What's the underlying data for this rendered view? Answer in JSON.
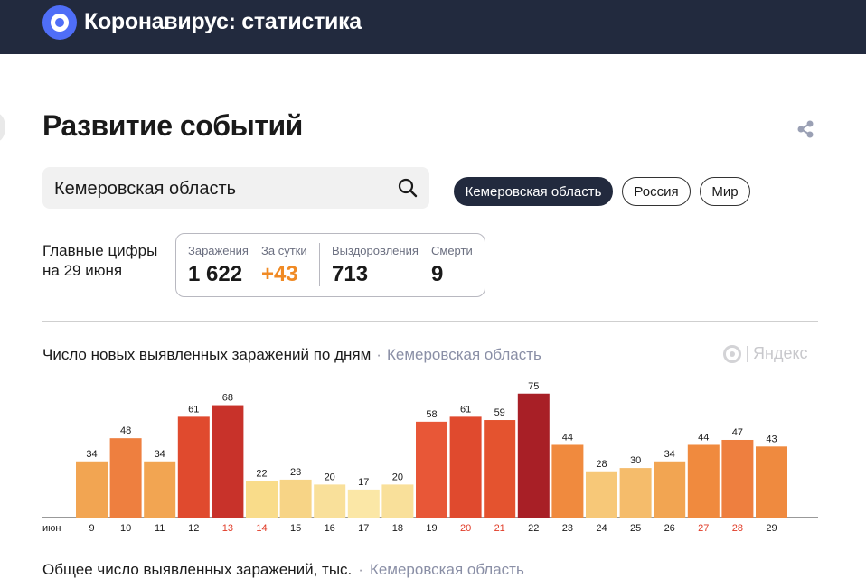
{
  "header": {
    "app_title": "Коронавирус: статистика",
    "logo_icon": "yandex-circle-logo"
  },
  "page": {
    "title": "Развитие событий",
    "share_icon": "share-icon"
  },
  "search": {
    "value": "Кемеровская область",
    "icon": "search-icon"
  },
  "region_chips": [
    {
      "label": "Кемеровская область",
      "active": true
    },
    {
      "label": "Россия",
      "active": false
    },
    {
      "label": "Мир",
      "active": false
    }
  ],
  "main_figures": {
    "label_line1": "Главные цифры",
    "label_line2": "на 29 июня",
    "infections_label": "Заражения",
    "infections_value": "1 622",
    "daily_label": "За сутки",
    "daily_value": "+43",
    "recovered_label": "Выздоровления",
    "recovered_value": "713",
    "deaths_label": "Смерти",
    "deaths_value": "9"
  },
  "chart_section": {
    "title": "Число новых выявленных заражений по дням",
    "separator": "·",
    "region": "Кемеровская область",
    "watermark": "Яндекс"
  },
  "footer_section": {
    "title": "Общее число выявленных заражений, тыс.",
    "separator": "·",
    "region": "Кемеровская область"
  },
  "colors": {
    "header_bg": "#222a3e",
    "accent": "#f08a24",
    "weekend_label": "#e03a26"
  },
  "chart_data": {
    "type": "bar",
    "title": "Число новых выявленных заражений по дням",
    "month_label": "июн",
    "categories": [
      "9",
      "10",
      "11",
      "12",
      "13",
      "14",
      "15",
      "16",
      "17",
      "18",
      "19",
      "20",
      "21",
      "22",
      "23",
      "24",
      "25",
      "26",
      "27",
      "28",
      "29"
    ],
    "values": [
      34,
      48,
      34,
      61,
      68,
      22,
      23,
      20,
      17,
      20,
      58,
      61,
      59,
      75,
      44,
      28,
      30,
      34,
      44,
      47,
      43
    ],
    "weekend_categories": [
      "13",
      "14",
      "20",
      "21",
      "27",
      "28"
    ],
    "bar_colors": [
      "#f2a552",
      "#ee7f3f",
      "#f2a552",
      "#e04a2e",
      "#c8322a",
      "#f9dc8a",
      "#f7d486",
      "#f9e09a",
      "#fbe7a6",
      "#f9e09a",
      "#e85737",
      "#e04a2e",
      "#e4532f",
      "#a81f26",
      "#f08a3e",
      "#f7c878",
      "#f5bc6b",
      "#f2a552",
      "#f08a3e",
      "#ee7f3f",
      "#ef8a3f"
    ],
    "ylim": [
      0,
      80
    ],
    "grid": false,
    "legend": "none"
  }
}
